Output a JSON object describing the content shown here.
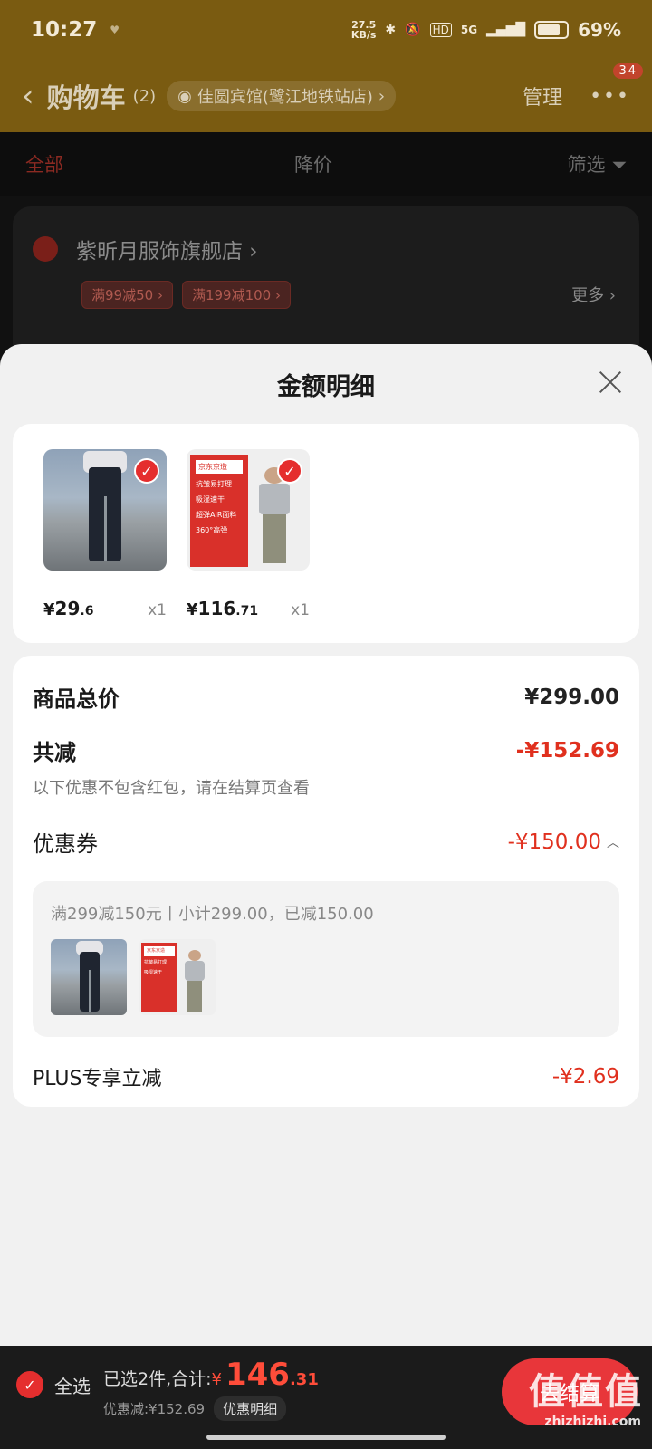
{
  "status_bar": {
    "time": "10:27",
    "speed_value": "27.5",
    "speed_unit": "KB/s",
    "network": "5G",
    "hd": "HD",
    "battery": "69%"
  },
  "header": {
    "back": "‹",
    "title": "购物车",
    "count": "(2)",
    "address": "佳圆宾馆(鹭江地铁站店)",
    "manage": "管理",
    "more": "•••",
    "badge": "34"
  },
  "tabs": {
    "all": "全部",
    "price_drop": "降价",
    "filter": "筛选"
  },
  "store": {
    "name": "紫昕月服饰旗舰店 ›",
    "coupons": [
      "满99减50 ›",
      "满199减100 ›"
    ],
    "more": "更多 ›"
  },
  "sheet": {
    "title": "金额明细",
    "products": [
      {
        "price_int": "29",
        "price_dec": ".6",
        "qty": "x1",
        "thumb": "jeans"
      },
      {
        "price_int": "116",
        "price_dec": ".71",
        "qty": "x1",
        "thumb": "pants",
        "thumb_tag": "京东京造",
        "thumb_lines": [
          "抗皱易打理",
          "吸湿速干",
          "超弹AIR面料",
          "360°高弹"
        ]
      }
    ],
    "currency": "¥",
    "total_label": "商品总价",
    "total_value": "¥299.00",
    "discount_label": "共减",
    "discount_value": "-¥152.69",
    "note": "以下优惠不包含红包，请在结算页查看",
    "coupon_label": "优惠券",
    "coupon_value": "-¥150.00",
    "coupon_detail": "满299减150元丨小计299.00，已减150.00",
    "plus_label": "PLUS专享立减",
    "plus_value": "-¥2.69"
  },
  "bottom": {
    "select_all": "全选",
    "selected": "已选2件,合计:",
    "currency": "¥",
    "total_int": "146",
    "total_dec": ".31",
    "discount": "优惠减:¥152.69",
    "detail_btn": "优惠明细",
    "checkout": "去结算",
    "watermark": "值值值",
    "watermark_url": "zhizhizhi.com"
  },
  "colors": {
    "accent": "#e0301e",
    "header_bg": "#7a5b11",
    "sheet_bg": "#f1f1f1"
  }
}
